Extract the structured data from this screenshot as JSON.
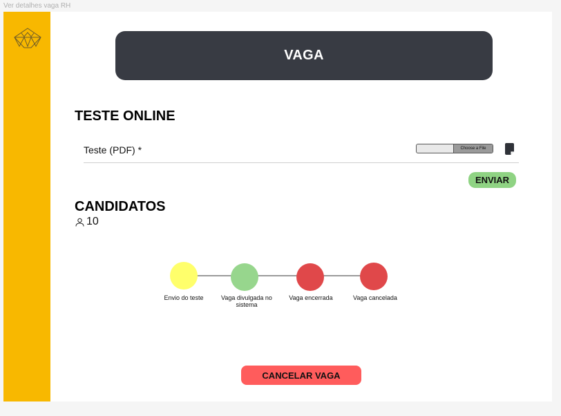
{
  "frame_title": "Ver detalhes vaga RH",
  "header": {
    "title": "VAGA"
  },
  "test_section": {
    "title": "TESTE ONLINE",
    "field_label": "Teste (PDF) *",
    "file_button_label": "Choose a File",
    "submit_label": "ENVIAR"
  },
  "candidates": {
    "title": "CANDIDATOS",
    "count": "10"
  },
  "timeline": {
    "steps": [
      {
        "label": "Envio do teste",
        "color": "#ffff6b"
      },
      {
        "label": "Vaga divulgada no sistema",
        "color": "#97d68d"
      },
      {
        "label": "Vaga encerrada",
        "color": "#e0484a"
      },
      {
        "label": "Vaga cancelada",
        "color": "#e0484a"
      }
    ]
  },
  "cancel_button": {
    "label": "CANCELAR VAGA"
  },
  "colors": {
    "sidebar": "#f8b800",
    "header_bar": "#383b43",
    "enviar": "#8fd383",
    "cancel": "#ff5c5c"
  }
}
